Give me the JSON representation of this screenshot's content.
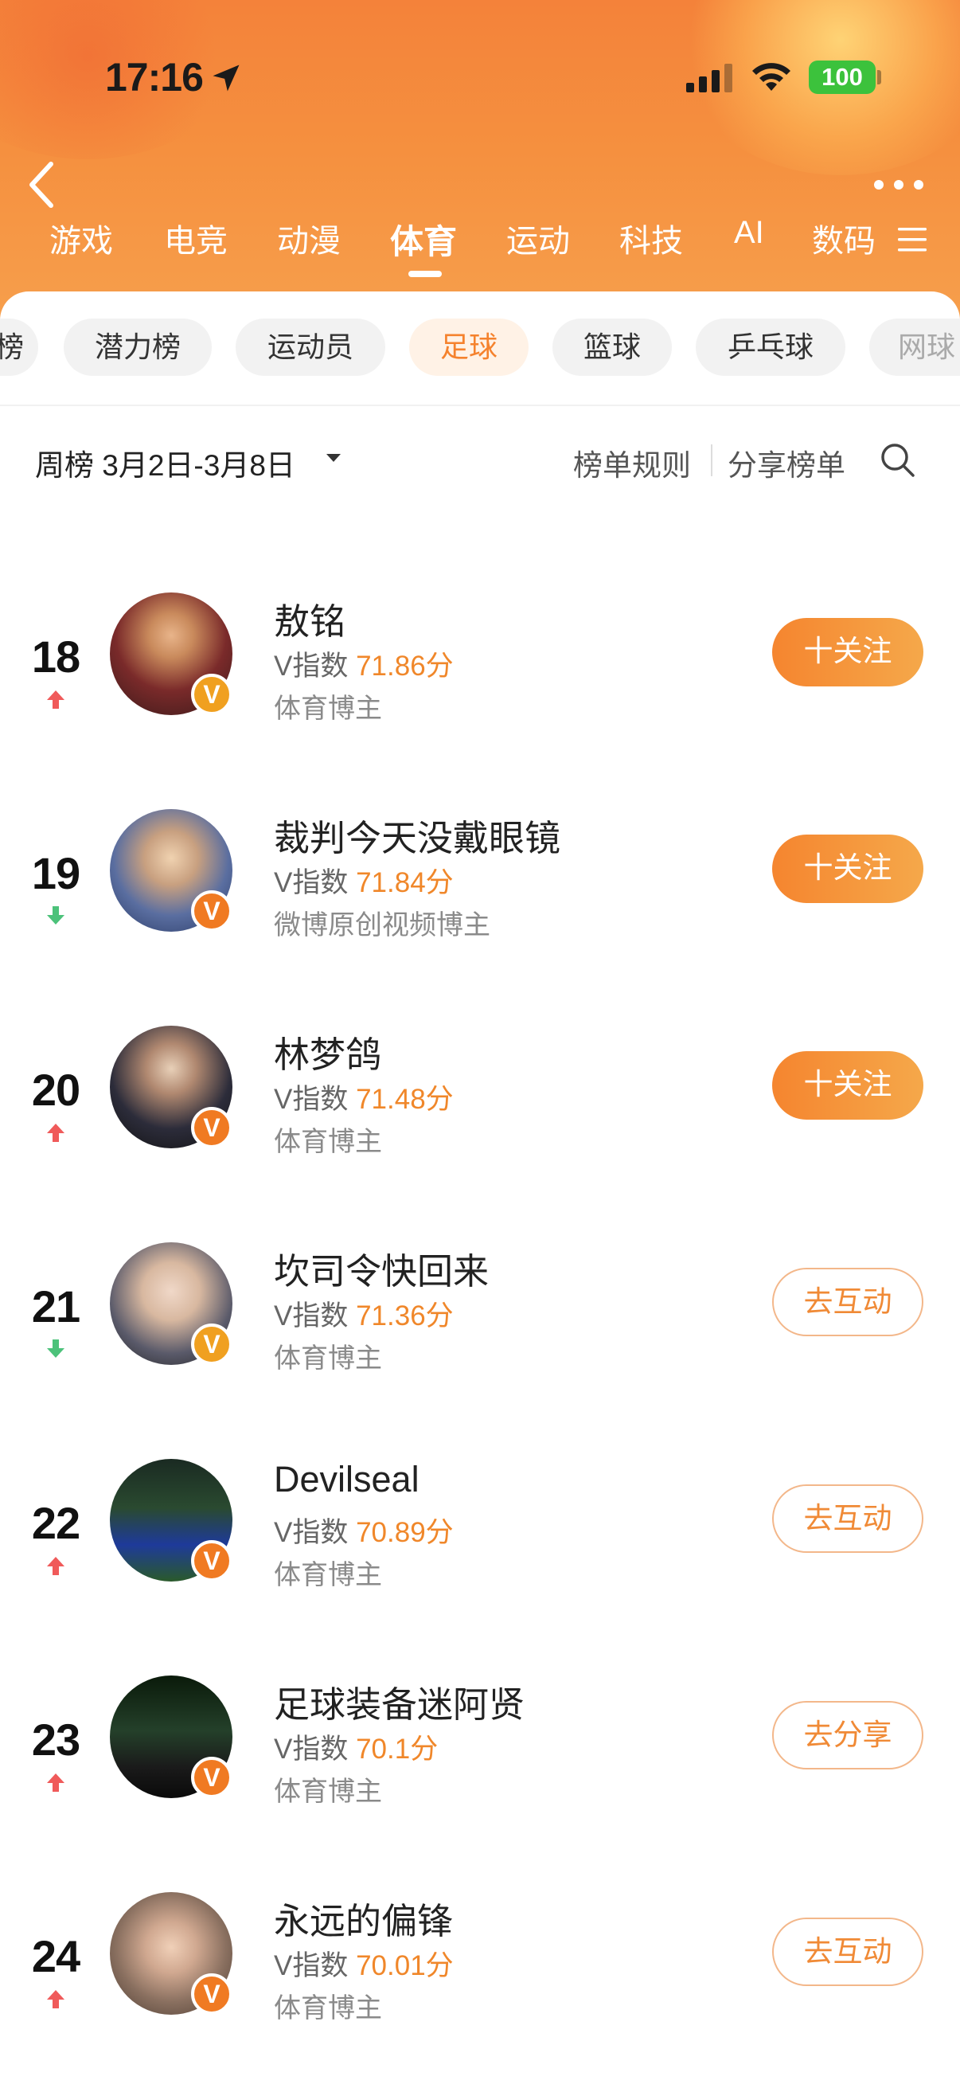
{
  "status_bar": {
    "time": "17:16",
    "battery": "100"
  },
  "nav": {
    "tabs": [
      "游戏",
      "电竞",
      "动漫",
      "体育",
      "运动",
      "科技",
      "AI",
      "数码"
    ],
    "active_tab": "体育"
  },
  "filters": {
    "chips": [
      "榜",
      "潜力榜",
      "运动员",
      "足球",
      "篮球",
      "乒乓球",
      "网球"
    ],
    "active_chip": "足球"
  },
  "toolbar": {
    "week_label": "周榜 3月2日-3月8日",
    "rules_label": "榜单规则",
    "share_label": "分享榜单"
  },
  "colors": {
    "accent": "#f5822d",
    "trend_up": "#f05a5a",
    "trend_down": "#4cc27a",
    "badge_orange": "#f07a22",
    "badge_gold": "#f0a020"
  },
  "list": [
    {
      "rank": "18",
      "trend": "up",
      "name": "敖铭",
      "vindex_label": "V指数",
      "score": "71.86分",
      "category": "体育博主",
      "button": "十关注",
      "button_style": "follow",
      "badge": "gold"
    },
    {
      "rank": "19",
      "trend": "down",
      "name": "裁判今天没戴眼镜",
      "vindex_label": "V指数",
      "score": "71.84分",
      "category": "微博原创视频博主",
      "button": "十关注",
      "button_style": "follow",
      "badge": "orange"
    },
    {
      "rank": "20",
      "trend": "up",
      "name": "林梦鸽",
      "vindex_label": "V指数",
      "score": "71.48分",
      "category": "体育博主",
      "button": "十关注",
      "button_style": "follow",
      "badge": "orange"
    },
    {
      "rank": "21",
      "trend": "down",
      "name": "坎司令快回来",
      "vindex_label": "V指数",
      "score": "71.36分",
      "category": "体育博主",
      "button": "去互动",
      "button_style": "outline",
      "badge": "gold"
    },
    {
      "rank": "22",
      "trend": "up",
      "name": "Devilseal",
      "vindex_label": "V指数",
      "score": "70.89分",
      "category": "体育博主",
      "button": "去互动",
      "button_style": "outline",
      "badge": "orange"
    },
    {
      "rank": "23",
      "trend": "up",
      "name": "足球装备迷阿贤",
      "vindex_label": "V指数",
      "score": "70.1分",
      "category": "体育博主",
      "button": "去分享",
      "button_style": "outline",
      "badge": "orange"
    },
    {
      "rank": "24",
      "trend": "up",
      "name": "永远的偏锋",
      "vindex_label": "V指数",
      "score": "70.01分",
      "category": "体育博主",
      "button": "去互动",
      "button_style": "outline",
      "badge": "orange"
    }
  ]
}
